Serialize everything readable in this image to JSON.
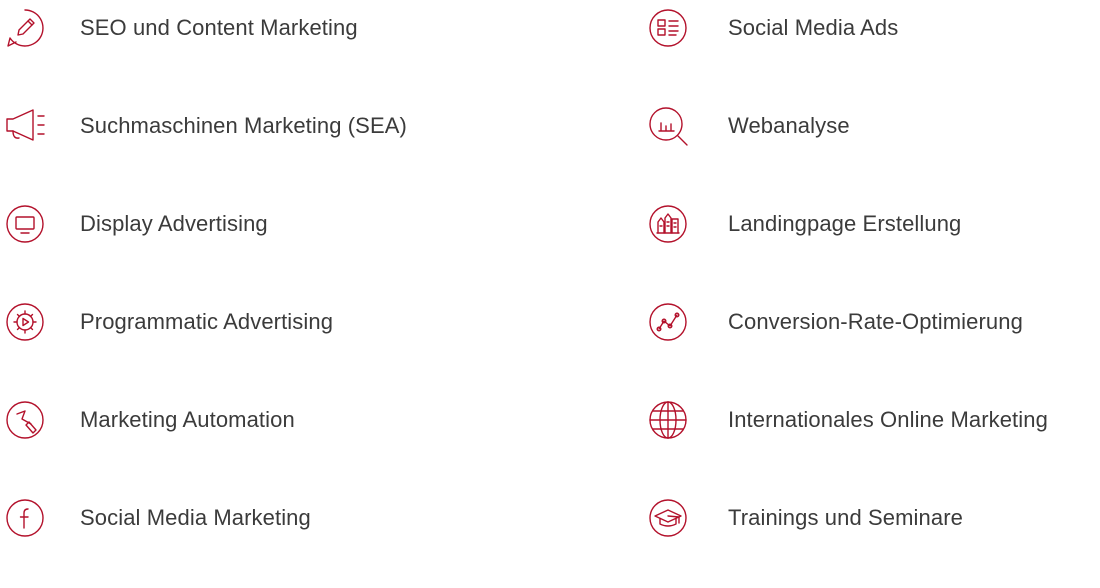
{
  "theme": {
    "accent": "#b3112b",
    "text": "#3b3b3b",
    "background": "#ffffff"
  },
  "services": {
    "left": [
      {
        "label": "SEO und Content Marketing",
        "icon": "pencil-bubble-icon"
      },
      {
        "label": "Suchmaschinen Marketing (SEA)",
        "icon": "megaphone-icon"
      },
      {
        "label": "Display Advertising",
        "icon": "monitor-icon"
      },
      {
        "label": "Programmatic Advertising",
        "icon": "gear-play-icon"
      },
      {
        "label": "Marketing Automation",
        "icon": "automation-icon"
      },
      {
        "label": "Social Media Marketing",
        "icon": "facebook-icon"
      }
    ],
    "right": [
      {
        "label": "Social Media Ads",
        "icon": "ad-layout-icon"
      },
      {
        "label": "Webanalyse",
        "icon": "analytics-magnifier-icon"
      },
      {
        "label": "Landingpage Erstellung",
        "icon": "buildings-icon"
      },
      {
        "label": "Conversion-Rate-Optimierung",
        "icon": "conversion-graph-icon"
      },
      {
        "label": "Internationales Online Marketing",
        "icon": "globe-icon"
      },
      {
        "label": "Trainings und Seminare",
        "icon": "graduation-cap-icon"
      }
    ]
  }
}
